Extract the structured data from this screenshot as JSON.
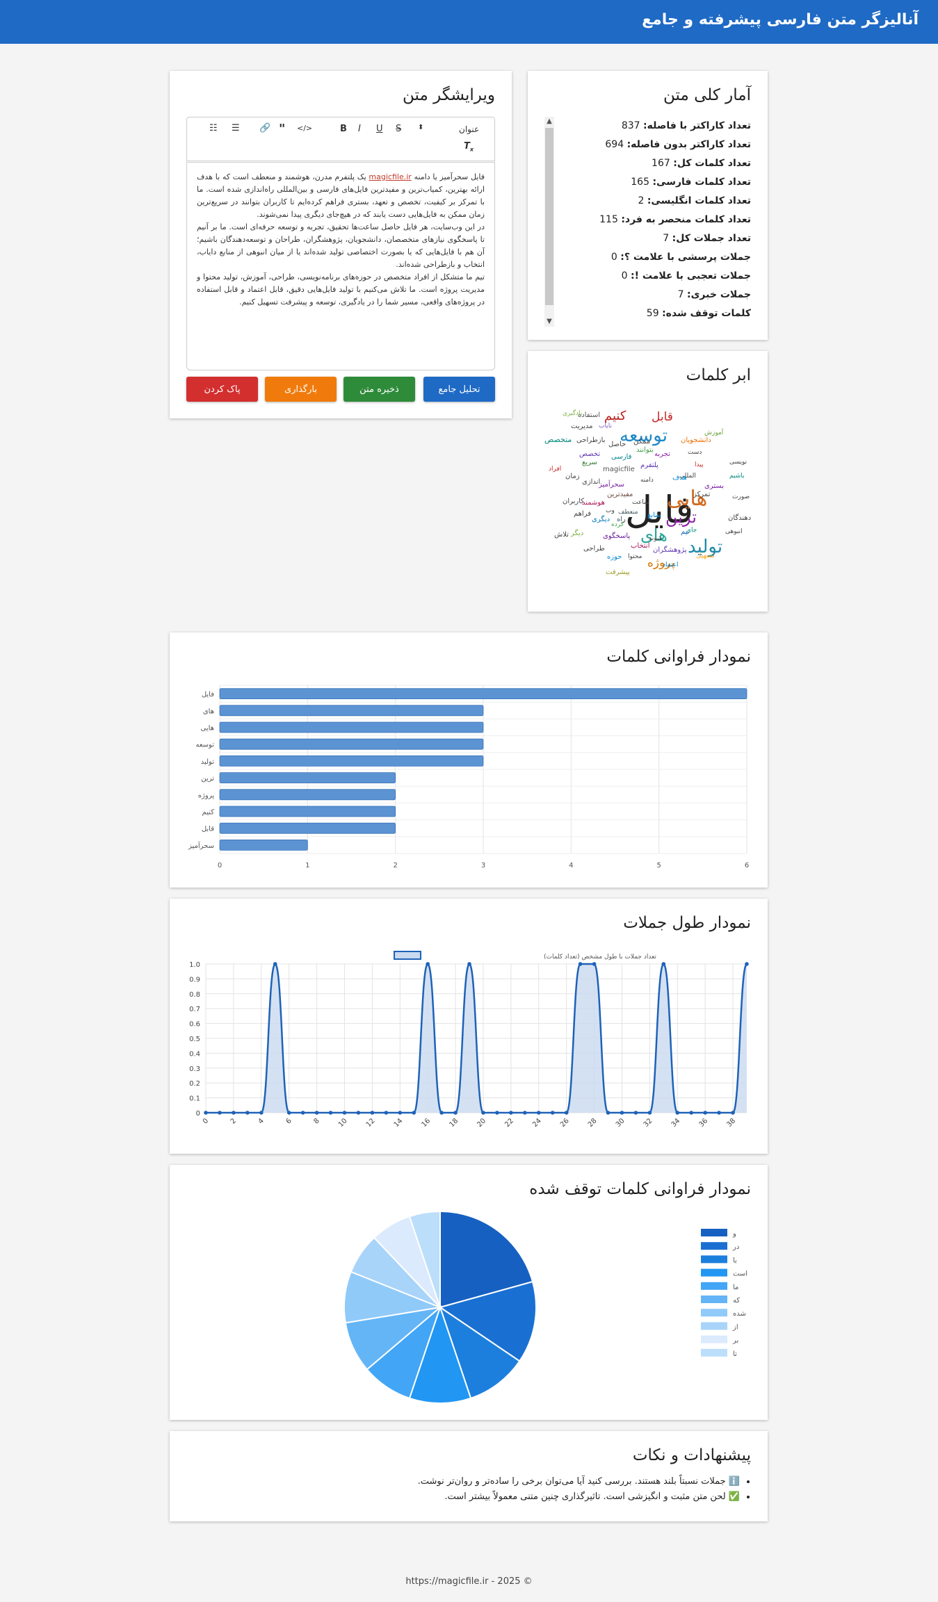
{
  "header": {
    "title": "آنالیزگر متن فارسی پیشرفته و جامع"
  },
  "stats": {
    "title": "آمار کلی متن",
    "rows": [
      {
        "label": "تعداد کاراکتر با فاصله:",
        "value": "837"
      },
      {
        "label": "تعداد کاراکتر بدون فاصله:",
        "value": "694"
      },
      {
        "label": "تعداد کلمات کل:",
        "value": "167"
      },
      {
        "label": "تعداد کلمات فارسی:",
        "value": "165"
      },
      {
        "label": "تعداد کلمات انگلیسی:",
        "value": "2"
      },
      {
        "label": "تعداد کلمات منحصر به فرد:",
        "value": "115"
      },
      {
        "label": "تعداد جملات کل:",
        "value": "7"
      },
      {
        "label": "جملات پرسشی با علامت ؟:",
        "value": "0"
      },
      {
        "label": "جملات تعجبی با علامت !:",
        "value": "0"
      },
      {
        "label": "جملات خبری:",
        "value": "7"
      },
      {
        "label": "کلمات توقف شده:",
        "value": "59"
      }
    ]
  },
  "editor": {
    "title": "ویرایشگر متن",
    "heading_select": "عنوان",
    "toolbar_icons": [
      "heading-select",
      "size-arrows-icon",
      "underline-icon",
      "italic-icon",
      "bold-icon",
      "code-icon",
      "quote-icon",
      "link-icon",
      "bullet-list-icon",
      "numbered-list-icon",
      "clear-format-icon"
    ],
    "p1_before": "فایل سحرآمیز یا دامنه ",
    "p1_link": "magicfile.ir",
    "p1_after": " یک پلتفرم مدرن، هوشمند و منعطف است که با هدف ارائه بهترین، کمیاب‌ترین و مفیدترین فایل‌های فارسی و بین‌المللی راه‌اندازی شده است. ما با تمرکز بر کیفیت، تخصص و تعهد، بستری فراهم کرده‌ایم تا کاربران بتوانند در سریع‌ترین زمان ممکن به فایل‌هایی دست یابند که در هیچ‌جای دیگری پیدا نمی‌شوند.",
    "p2": "در این وب‌سایت، هر فایل حاصل ساعت‌ها تحقیق، تجربه و توسعه حرفه‌ای است. ما بر آنیم تا پاسخگوی نیازهای متخصصان، دانشجویان، پژوهشگران، طراحان و توسعه‌دهندگان باشیم؛ آن هم با فایل‌هایی که یا بصورت اختصاصی تولید شده‌اند یا از میان انبوهی از منابع دایاب، انتخاب و بازطراحی شده‌اند.",
    "p3": "تیم ما متشکل از افراد متخصص در حوزه‌های برنامه‌نویسی، طراحی، آموزش، تولید محتوا و مدیریت پروژه است. ما تلاش می‌کنیم با تولید فایل‌هایی دقیق، قابل اعتماد و قابل استفاده در پروژه‌های واقعی، مسیر شما را در یادگیری، توسعه و پیشرفت تسهیل کنیم.",
    "buttons": {
      "analyze": "تحلیل جامع",
      "save": "ذخیره متن",
      "load": "بارگذاری",
      "clear": "پاک کردن"
    },
    "colors": {
      "analyze": "#1e6ac5",
      "save": "#2e8b3a",
      "load": "#f07b0c",
      "clear": "#d32f2f"
    }
  },
  "wordcloud": {
    "title": "ابر کلمات",
    "words": [
      {
        "t": "فایل",
        "c": "#222222"
      },
      {
        "t": "هایی",
        "c": "#d2691e"
      },
      {
        "t": "ترین",
        "c": "#8e24aa"
      },
      {
        "t": "تولید",
        "c": "#1e88a8"
      },
      {
        "t": "توسعه",
        "c": "#1e88c8"
      },
      {
        "t": "های",
        "c": "#26a69a"
      },
      {
        "t": "کنیم",
        "c": "#b71c1c"
      },
      {
        "t": "قابل",
        "c": "#c62828"
      },
      {
        "t": "پروژه",
        "c": "#d47500"
      },
      {
        "t": "magicfile",
        "c": "#555555"
      },
      {
        "t": "استفاده",
        "c": "#555555"
      },
      {
        "t": "یادگیری",
        "c": "#7cb342"
      },
      {
        "t": "مدیریت",
        "c": "#444444"
      },
      {
        "t": "نایاب",
        "c": "#7e57c2"
      },
      {
        "t": "دانشجویان",
        "c": "#ef6c00"
      },
      {
        "t": "آموزش",
        "c": "#689f38"
      },
      {
        "t": "متخصص",
        "c": "#00897b"
      },
      {
        "t": "بازطراحی",
        "c": "#444444"
      },
      {
        "t": "حاصل",
        "c": "#444444"
      },
      {
        "t": "ممکن",
        "c": "#444444"
      },
      {
        "t": "بتوانند",
        "c": "#43a047"
      },
      {
        "t": "تجربه",
        "c": "#8e24aa"
      },
      {
        "t": "تخصص",
        "c": "#5e35b1"
      },
      {
        "t": "پلتفرم",
        "c": "#5e35b1"
      },
      {
        "t": "فارسی",
        "c": "#00838f"
      },
      {
        "t": "سریع",
        "c": "#2e7d32"
      },
      {
        "t": "ساعت",
        "c": "#444444"
      },
      {
        "t": "افراد",
        "c": "#c62828"
      },
      {
        "t": "زمان",
        "c": "#444444"
      },
      {
        "t": "اندازی",
        "c": "#444444"
      },
      {
        "t": "سحرآمیز",
        "c": "#7b1fa2"
      },
      {
        "t": "مفیدترین",
        "c": "#6d4c41"
      },
      {
        "t": "هوشمند",
        "c": "#ad1457"
      },
      {
        "t": "کاربران",
        "c": "#444444"
      },
      {
        "t": "فراهم",
        "c": "#444444"
      },
      {
        "t": "وب",
        "c": "#444444"
      },
      {
        "t": "منعطف",
        "c": "#455a64"
      },
      {
        "t": "راه",
        "c": "#455a64"
      },
      {
        "t": "دیگری",
        "c": "#0277bd"
      },
      {
        "t": "کرده",
        "c": "#43a047"
      },
      {
        "t": "پاسخگوی",
        "c": "#6a1b9a"
      },
      {
        "t": "طراحی",
        "c": "#444444"
      },
      {
        "t": "پژوهشگران",
        "c": "#5e35b1"
      },
      {
        "t": "انتخاب",
        "c": "#ad1457"
      },
      {
        "t": "محتوا",
        "c": "#444444"
      },
      {
        "t": "حوزه",
        "c": "#0288d1"
      },
      {
        "t": "اعتماد",
        "c": "#0277bd"
      },
      {
        "t": "تسهیل",
        "c": "#f9a825"
      },
      {
        "t": "پیشرفت",
        "c": "#9e9d24"
      },
      {
        "t": "دهندگان",
        "c": "#444444"
      },
      {
        "t": "انبوهی",
        "c": "#444444"
      },
      {
        "t": "منابع",
        "c": "#0288d1"
      },
      {
        "t": "بستری",
        "c": "#7b1fa2"
      },
      {
        "t": "نویسی",
        "c": "#444444"
      },
      {
        "t": "باشیم",
        "c": "#00897b"
      },
      {
        "t": "صورت",
        "c": "#444444"
      },
      {
        "t": "تلاش",
        "c": "#444444"
      },
      {
        "t": "دست",
        "c": "#444444"
      },
      {
        "t": "المللی",
        "c": "#444444"
      },
      {
        "t": "دامنه",
        "c": "#444444"
      },
      {
        "t": "هدف",
        "c": "#0288d1"
      },
      {
        "t": "پیدا",
        "c": "#c62828"
      },
      {
        "t": "تمرکز",
        "c": "#444444"
      },
      {
        "t": "شوند",
        "c": "#444444"
      },
      {
        "t": "دیگر",
        "c": "#7cb342"
      },
      {
        "t": "تیم",
        "c": "#1565c0"
      },
      {
        "t": "جای",
        "c": "#00897b"
      }
    ]
  },
  "word_freq": {
    "title": "نمودار فراوانی کلمات",
    "chart_data": {
      "type": "bar",
      "orientation": "horizontal",
      "categories": [
        "فایل",
        "های",
        "هایی",
        "توسعه",
        "تولید",
        "ترین",
        "پروژه",
        "کنیم",
        "قابل",
        "سحرآمیز"
      ],
      "values": [
        6,
        3,
        3,
        3,
        3,
        2,
        2,
        2,
        2,
        1
      ],
      "xlim": [
        0,
        6
      ],
      "xticks": [
        "0",
        "1",
        "2",
        "3",
        "4",
        "5",
        "6"
      ],
      "grid": true,
      "color": "#5b93d3"
    }
  },
  "sentence_len": {
    "title": "نمودار طول جملات",
    "chart_data": {
      "type": "line",
      "series": [
        {
          "name": "تعداد جملات با طول مشخص (تعداد کلمات)",
          "values": [
            0,
            0,
            0,
            0,
            0,
            1,
            0,
            0,
            0,
            0,
            0,
            0,
            0,
            0,
            0,
            0,
            1,
            0,
            0,
            1,
            0,
            0,
            0,
            0,
            0,
            0,
            0,
            1,
            1,
            0,
            0,
            0,
            0,
            1,
            0,
            0,
            0,
            0,
            0,
            1
          ]
        }
      ],
      "x": [
        0,
        1,
        2,
        3,
        4,
        5,
        6,
        7,
        8,
        9,
        10,
        11,
        12,
        13,
        14,
        15,
        16,
        17,
        18,
        19,
        20,
        21,
        22,
        23,
        24,
        25,
        26,
        27,
        28,
        29,
        30,
        31,
        32,
        33,
        34,
        35,
        36,
        37,
        38,
        39
      ],
      "xticks": [
        "0",
        "2",
        "4",
        "6",
        "8",
        "10",
        "12",
        "14",
        "16",
        "18",
        "20",
        "22",
        "24",
        "26",
        "28",
        "30",
        "32",
        "34",
        "36",
        "38"
      ],
      "ylim": [
        0,
        1
      ],
      "yticks": [
        "0",
        "0.1",
        "0.2",
        "0.3",
        "0.4",
        "0.5",
        "0.6",
        "0.7",
        "0.8",
        "0.9",
        "1.0"
      ],
      "grid": true,
      "color": "#1e62b8",
      "fill": "#c9d9ef"
    }
  },
  "stopwords": {
    "title": "نمودار فراوانی کلمات توقف شده",
    "chart_data": {
      "type": "pie",
      "categories": [
        "و",
        "در",
        "با",
        "است",
        "ما",
        "که",
        "شده",
        "از",
        "بر",
        "تا"
      ],
      "values": [
        12,
        8,
        6,
        6,
        5,
        5,
        5,
        4,
        4,
        3
      ],
      "colors": [
        "#1660c2",
        "#1a70d2",
        "#1d7fdd",
        "#2196f3",
        "#42a5f5",
        "#64b5f6",
        "#90caf9",
        "#a8d4fa",
        "#dbeafc",
        "#bbdefb"
      ],
      "legend": "right"
    }
  },
  "tips": {
    "title": "پیشنهادات و نکات",
    "items": [
      "ℹ️ جملات نسبتاً بلند هستند. بررسی کنید آیا می‌توان برخی را ساده‌تر و روان‌تر نوشت.",
      "✅ لحن متن مثبت و انگیزشی است. تاثیرگذاری چنین متنی معمولاً بیشتر است."
    ]
  },
  "footer": {
    "text": "https://magicfile.ir - 2025 ©"
  }
}
